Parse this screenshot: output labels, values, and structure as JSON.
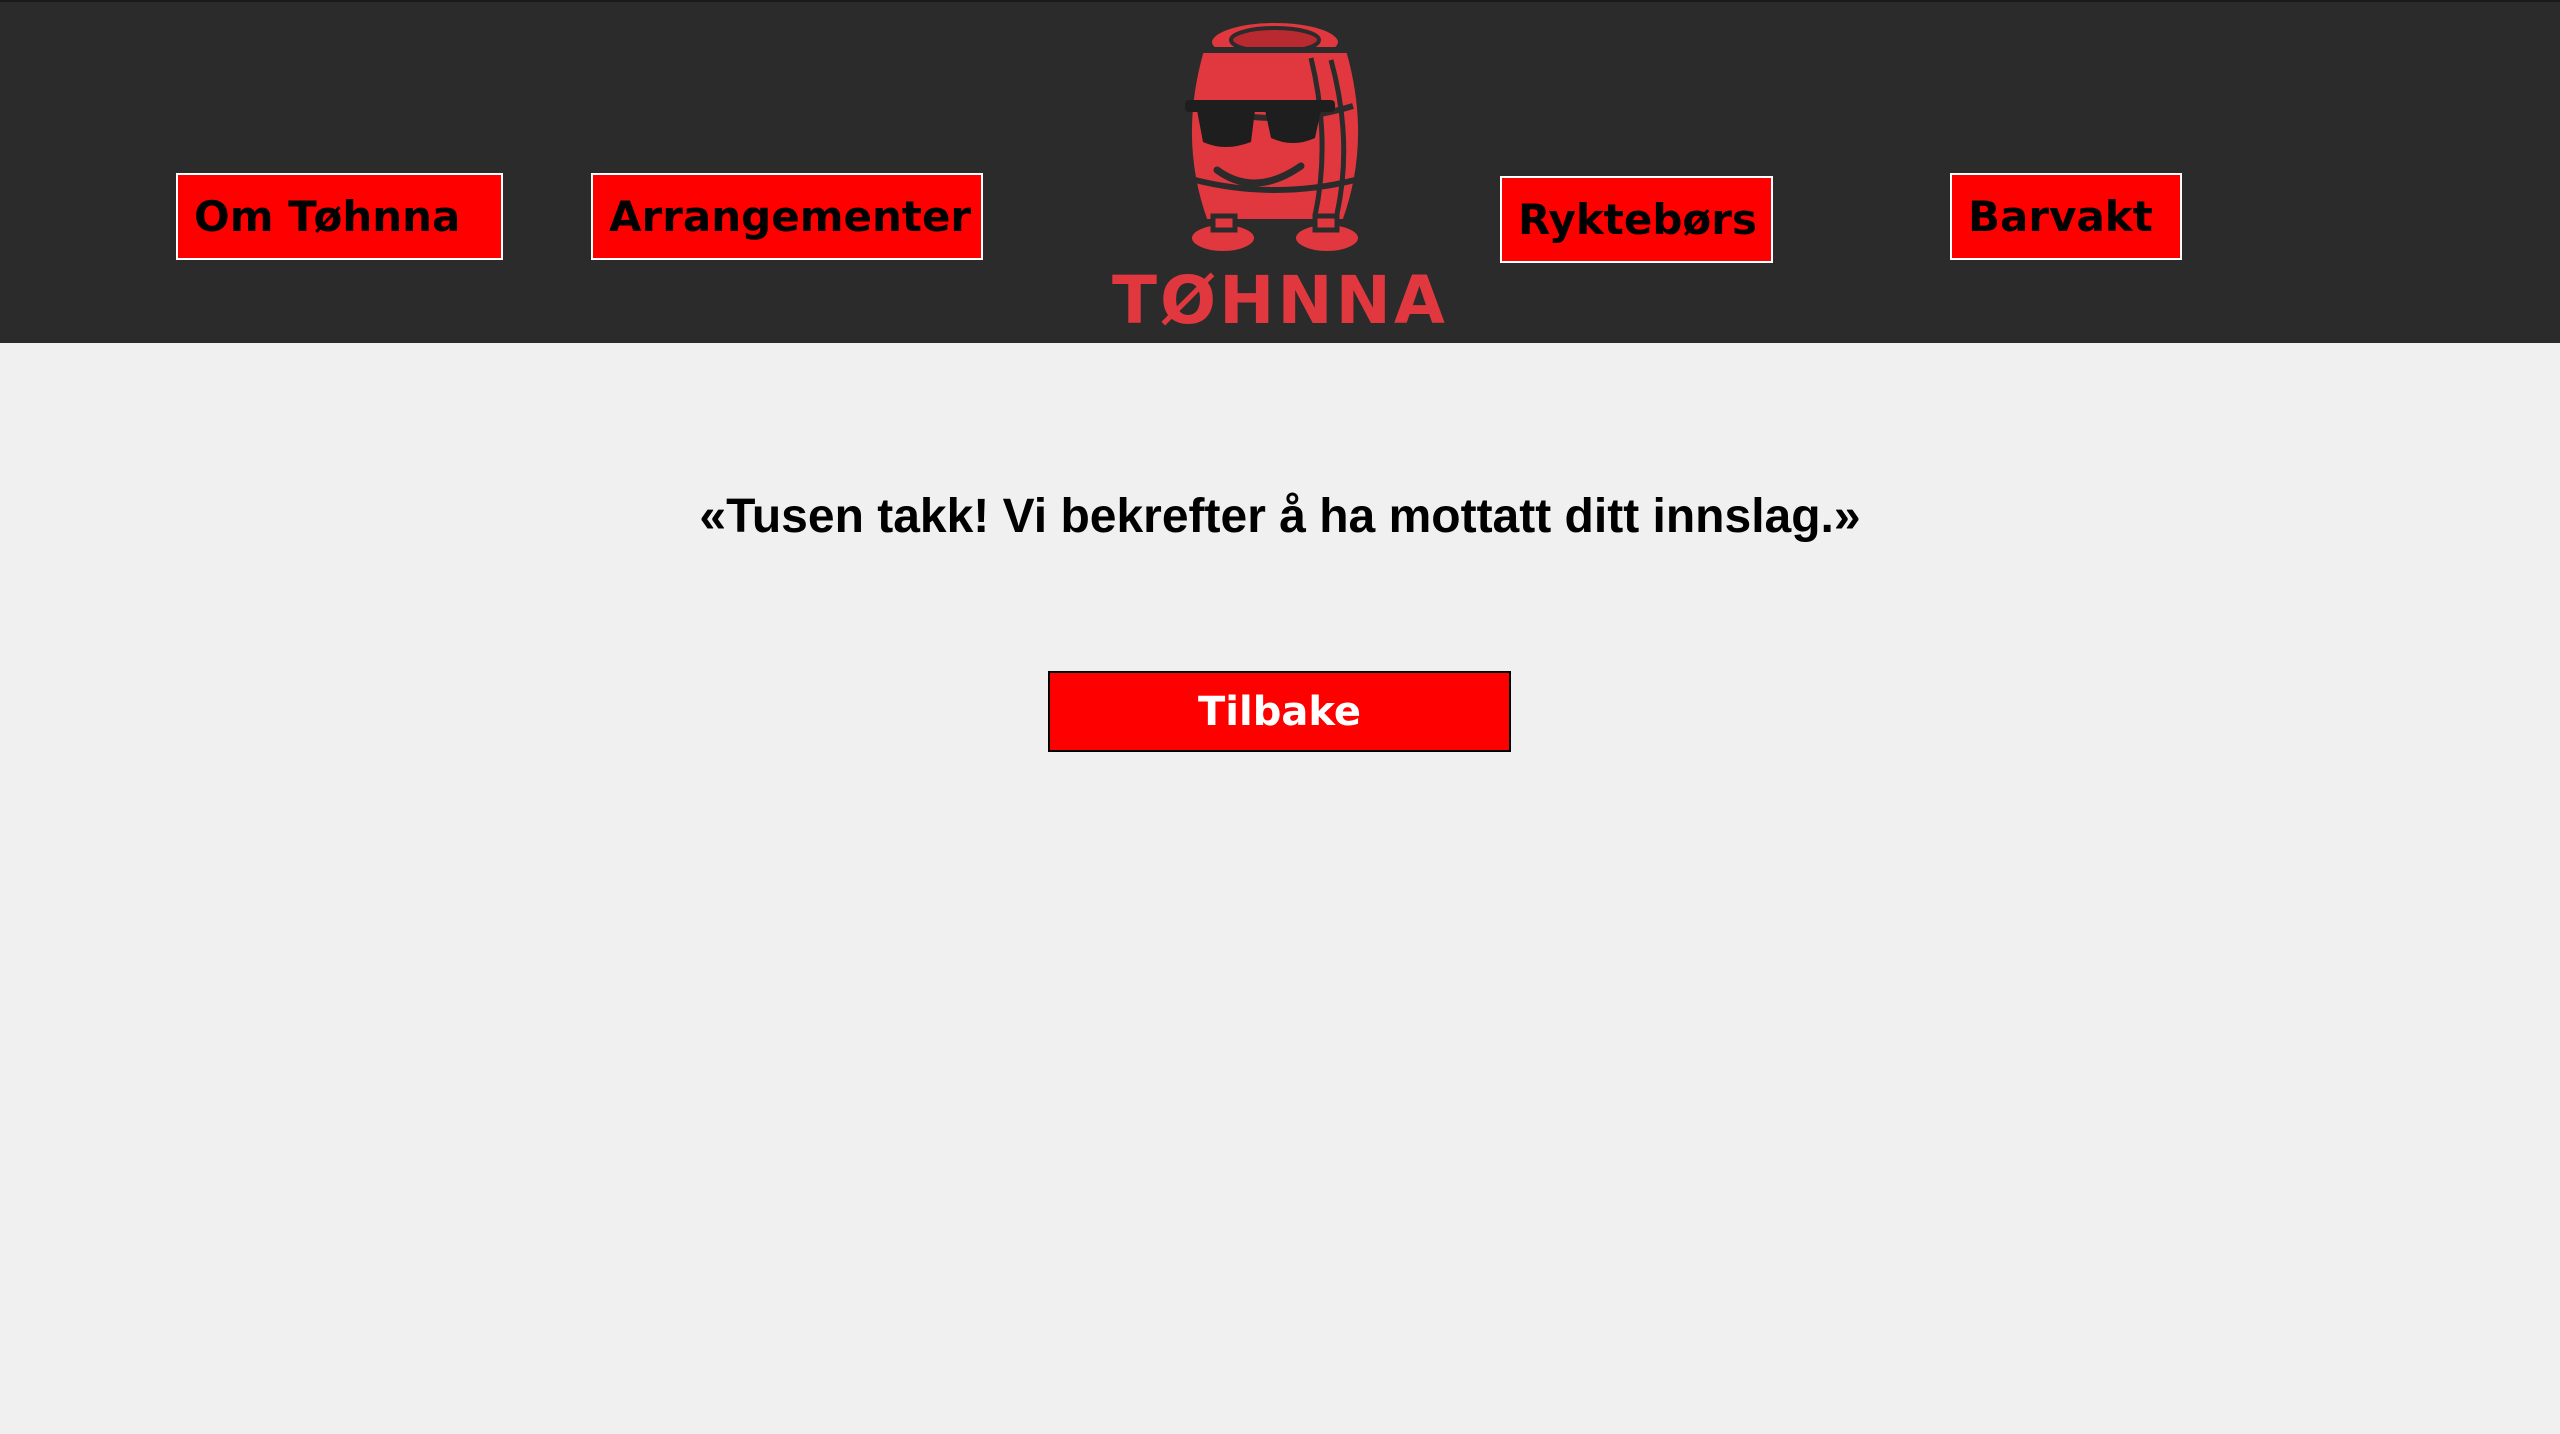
{
  "nav": {
    "items": [
      {
        "label": "Om Tøhnna"
      },
      {
        "label": "Arrangementer"
      },
      {
        "label": "Ryktebørs"
      },
      {
        "label": "Barvakt"
      }
    ]
  },
  "logo": {
    "wordmark": "TØHNNA",
    "icon": "barrel-mascot-with-sunglasses-icon",
    "color": "#e0383e"
  },
  "main": {
    "message": "«Tusen takk! Vi bekrefter å ha mottatt ditt innslag.»",
    "back_label": "Tilbake"
  },
  "colors": {
    "header_bg": "#2b2b2b",
    "page_bg": "#f0f0f0",
    "button_red": "#ff0000"
  }
}
